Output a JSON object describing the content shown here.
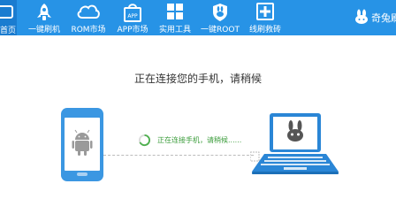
{
  "topbar": {
    "home_label": "首页",
    "nav": [
      {
        "label": "一键刷机",
        "icon": "rocket-icon"
      },
      {
        "label": "ROM市场",
        "icon": "cloud-icon"
      },
      {
        "label": "APP市场",
        "icon": "app-bag-icon"
      },
      {
        "label": "实用工具",
        "icon": "grid-tools-icon"
      },
      {
        "label": "一键ROOT",
        "icon": "shield-rabbit-icon"
      },
      {
        "label": "线刷救砖",
        "icon": "plus-box-icon"
      }
    ],
    "brand": {
      "label": "奇兔刷",
      "icon": "rabbit-logo-icon"
    }
  },
  "main": {
    "title": "正在连接您的手机，请稍候",
    "status": "正在连接手机，请稍候......"
  },
  "colors": {
    "accent": "#2793e6",
    "accent_dark": "#1a7cd0",
    "phone": "#3b97e2",
    "status_green": "#3c9d3c"
  }
}
